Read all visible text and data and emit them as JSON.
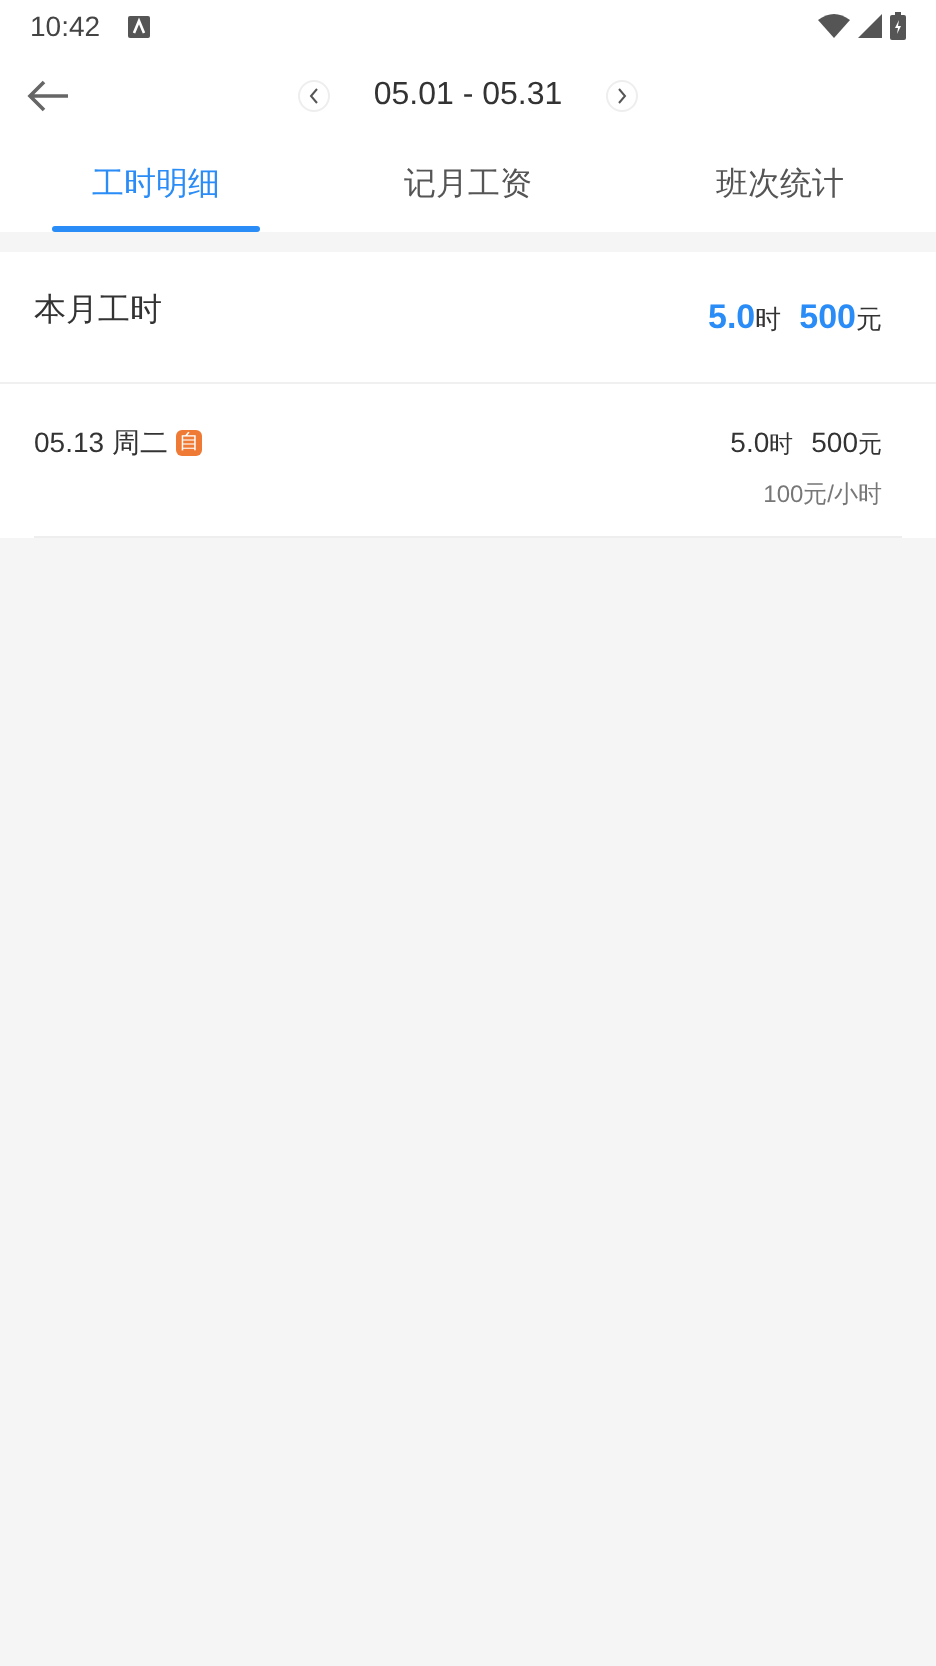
{
  "status_bar": {
    "time": "10:42"
  },
  "header": {
    "date_range": "05.01 - 05.31"
  },
  "tabs": [
    {
      "label": "工时明细",
      "selected": true
    },
    {
      "label": "记月工资",
      "selected": false
    },
    {
      "label": "班次统计",
      "selected": false
    }
  ],
  "summary": {
    "title": "本月工时",
    "hours": "5.0",
    "hours_unit": "时",
    "amount": "500",
    "amount_unit": "元"
  },
  "records": [
    {
      "date": "05.13 周二",
      "tag": "自",
      "hours": "5.0",
      "hours_unit": "时",
      "amount": "500",
      "amount_unit": "元",
      "rate": "100元/小时"
    }
  ]
}
